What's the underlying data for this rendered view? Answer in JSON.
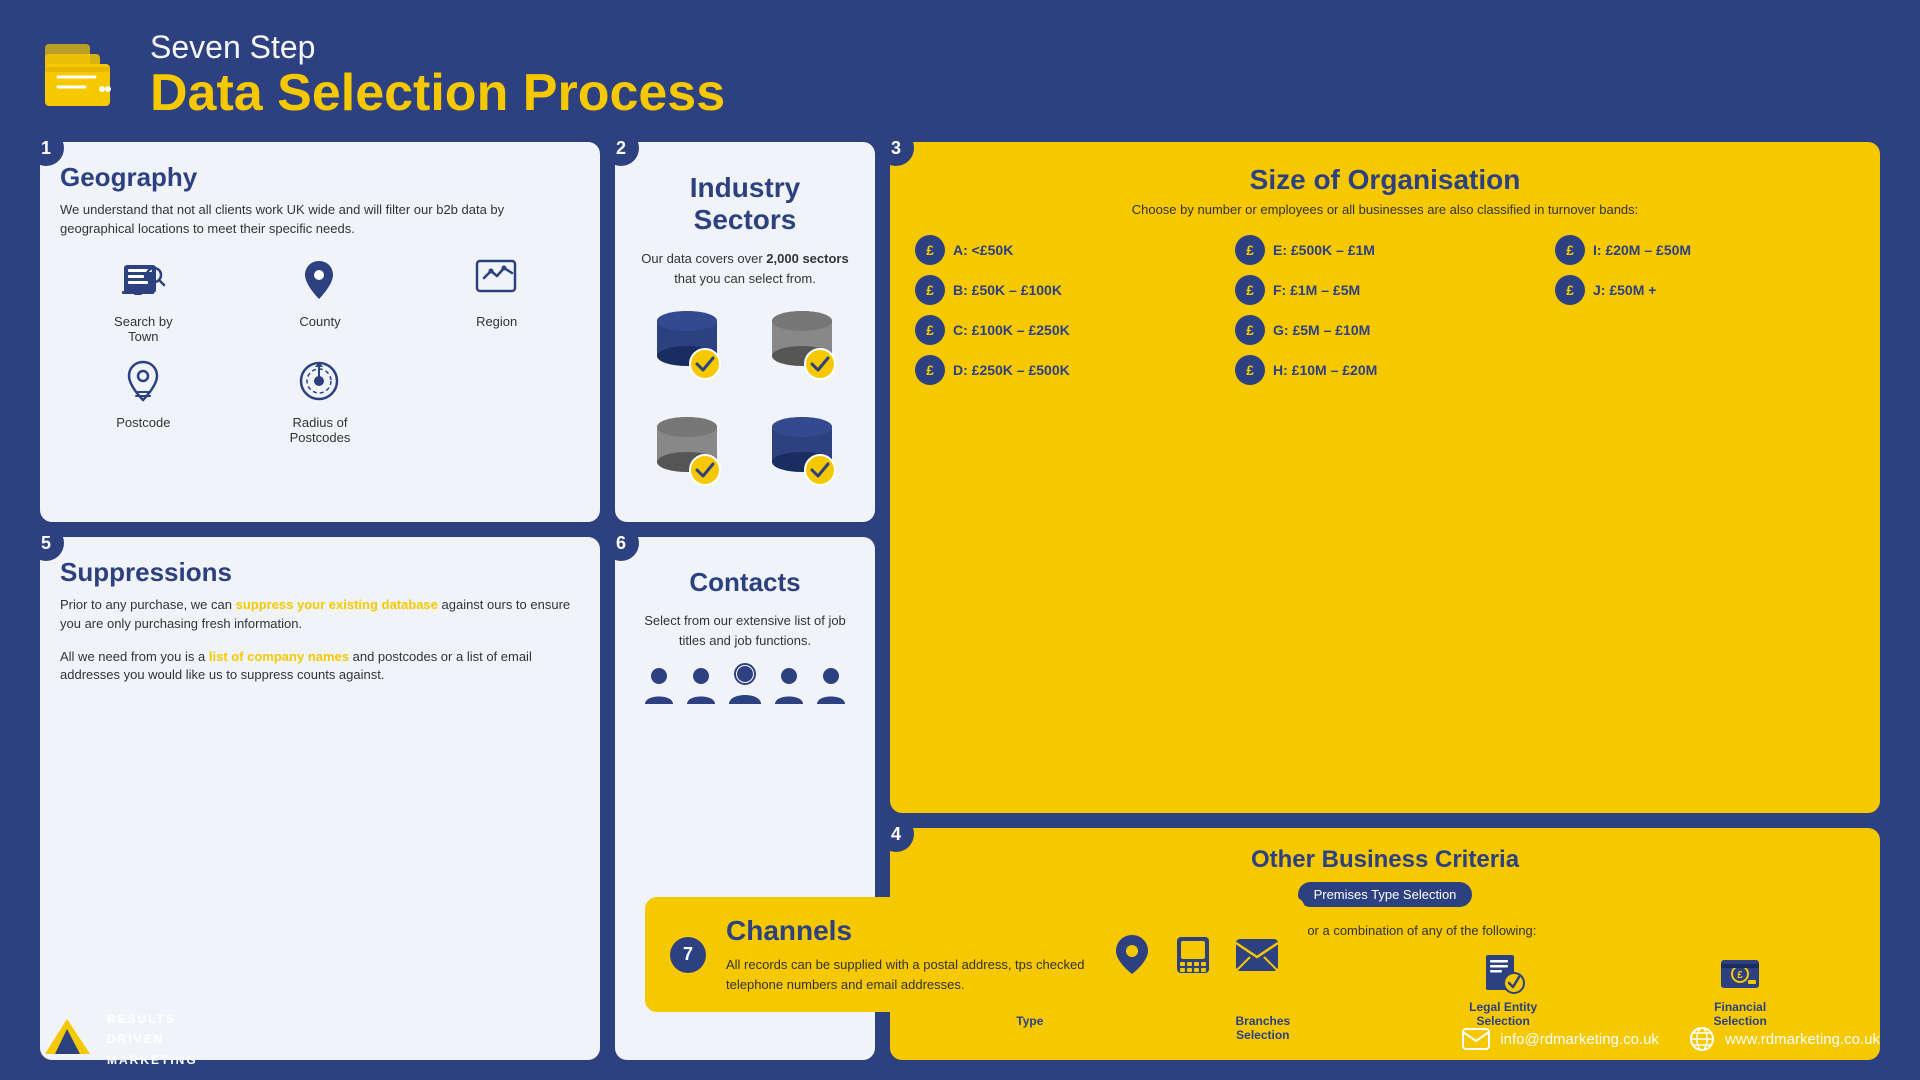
{
  "header": {
    "subtitle": "Seven Step",
    "title": "Data Selection Process"
  },
  "steps": {
    "step1": {
      "badge": "1",
      "title": "Geography",
      "description": "We understand that not all clients work UK wide and will filter our b2b data by geographical locations to meet their specific needs.",
      "icons": [
        {
          "label": "Search by Town",
          "icon": "🏢"
        },
        {
          "label": "County",
          "icon": "📍"
        },
        {
          "label": "Region",
          "icon": "🗺"
        },
        {
          "label": "Postcode",
          "icon": "📮"
        },
        {
          "label": "Radius of Postcodes",
          "icon": "🎯"
        }
      ]
    },
    "step2": {
      "badge": "2",
      "title": "Industry Sectors",
      "description": "Our data covers over ",
      "highlight": "2,000 sectors",
      "description2": " that you can select from."
    },
    "step3": {
      "badge": "3",
      "title": "Size of Organisation",
      "subtitle": "Choose by number or employees or all businesses are also classified in turnover bands:",
      "bands": [
        {
          "label": "A: <£50K"
        },
        {
          "label": "E: £500K – £1M"
        },
        {
          "label": "I: £20M – £50M"
        },
        {
          "label": "B: £50K – £100K"
        },
        {
          "label": "F: £1M – £5M"
        },
        {
          "label": "J: £50M +"
        },
        {
          "label": "C: £100K – £250K"
        },
        {
          "label": "G: £5M – £10M"
        },
        {
          "label": ""
        },
        {
          "label": "D: £250K – £500K"
        },
        {
          "label": "H: £10M – £20M"
        },
        {
          "label": ""
        }
      ]
    },
    "step4": {
      "badge": "4",
      "title": "Other Business Criteria",
      "badge_label": "Premises Type Selection",
      "subtitle": "Choose one or a combination of any of the following:",
      "items": [
        {
          "label": "Premises Type",
          "icon": "🏢"
        },
        {
          "label": "Number of Branches Selection",
          "icon": "🏘"
        },
        {
          "label": "Legal Entity Selection",
          "icon": "⚖"
        },
        {
          "label": "Financial Selection",
          "icon": "💷"
        }
      ]
    },
    "step5": {
      "badge": "5",
      "title": "Suppressions",
      "text1": "Prior to any purchase, we can ",
      "highlight1": "suppress your existing database",
      "text2": " against ours to ensure you are only purchasing fresh information.",
      "text3": "All we need from you is a ",
      "highlight2": "list of company names",
      "text4": " and postcodes or a list of email addresses you would like us to suppress counts against."
    },
    "step6": {
      "badge": "6",
      "title": "Contacts",
      "description": "Select from our extensive list of job titles and job functions."
    },
    "step7": {
      "badge": "7",
      "title": "Channels",
      "description": "All records can be supplied with a postal address, tps checked telephone numbers and email addresses."
    }
  },
  "footer": {
    "logo_lines": [
      "RESULTS",
      "DRIVEN",
      "MARKETING"
    ],
    "email": "info@rdmarketing.co.uk",
    "website": "www.rdmarketing.co.uk"
  }
}
